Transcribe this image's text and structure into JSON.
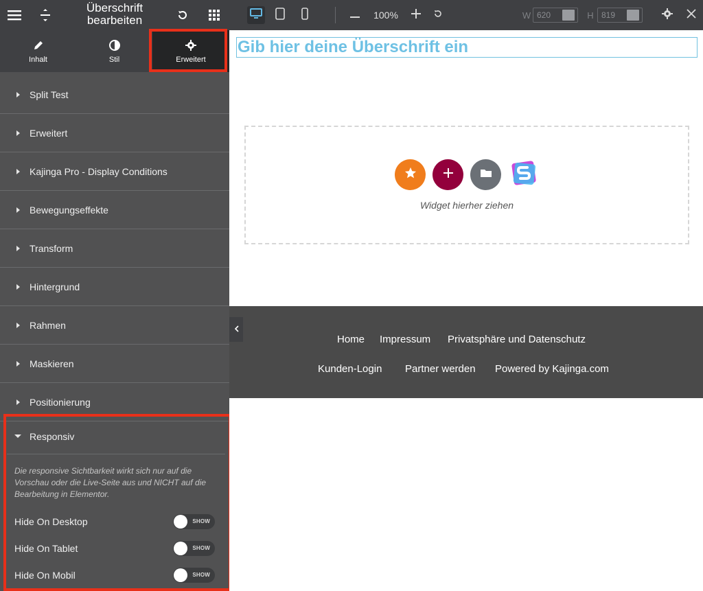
{
  "panel": {
    "title": "Überschrift bearbeiten",
    "icons": {
      "menu": "hamburger-icon",
      "drag": "drag-handle-icon",
      "history": "undo-icon",
      "widgets": "grid-icon"
    },
    "tabs": [
      {
        "label": "Inhalt",
        "icon": "pencil-icon"
      },
      {
        "label": "Stil",
        "icon": "half-circle-icon"
      },
      {
        "label": "Erweitert",
        "icon": "gear-icon",
        "active": true
      }
    ],
    "sections": [
      {
        "label": "Split Test"
      },
      {
        "label": "Erweitert"
      },
      {
        "label": "Kajinga Pro - Display Conditions"
      },
      {
        "label": "Bewegungseffekte"
      },
      {
        "label": "Transform"
      },
      {
        "label": "Hintergrund"
      },
      {
        "label": "Rahmen"
      },
      {
        "label": "Maskieren"
      },
      {
        "label": "Positionierung"
      }
    ],
    "responsive": {
      "label": "Responsiv",
      "note": "Die responsive Sichtbarkeit wirkt sich nur auf die Vorschau oder die Live-Seite aus und NICHT auf die Bearbeitung in Elementor.",
      "toggles": [
        {
          "label": "Hide On Desktop",
          "state": "SHOW"
        },
        {
          "label": "Hide On Tablet",
          "state": "SHOW"
        },
        {
          "label": "Hide On Mobil",
          "state": "SHOW"
        }
      ]
    }
  },
  "toolbar": {
    "zoom": "100%",
    "width_label": "W",
    "width_value": "620",
    "height_label": "H",
    "height_value": "819"
  },
  "canvas": {
    "heading": "Gib hier deine Überschrift ein",
    "dropzone_caption": "Widget hierher ziehen",
    "footer_row1": [
      "Home",
      "Impressum",
      "Privatsphäre und Datenschutz"
    ],
    "footer_row2": [
      "Kunden-Login",
      "Partner werden",
      "Powered by Kajinga.com"
    ]
  },
  "colors": {
    "panel_bg": "#515152",
    "header_bg": "#3f4043",
    "highlight": "#e8301a",
    "heading": "#6ec1e4",
    "footer_bg": "#4a4a4a",
    "btn_orange": "#f07d1c",
    "btn_maroon": "#93003c",
    "btn_gray": "#6b7076"
  }
}
